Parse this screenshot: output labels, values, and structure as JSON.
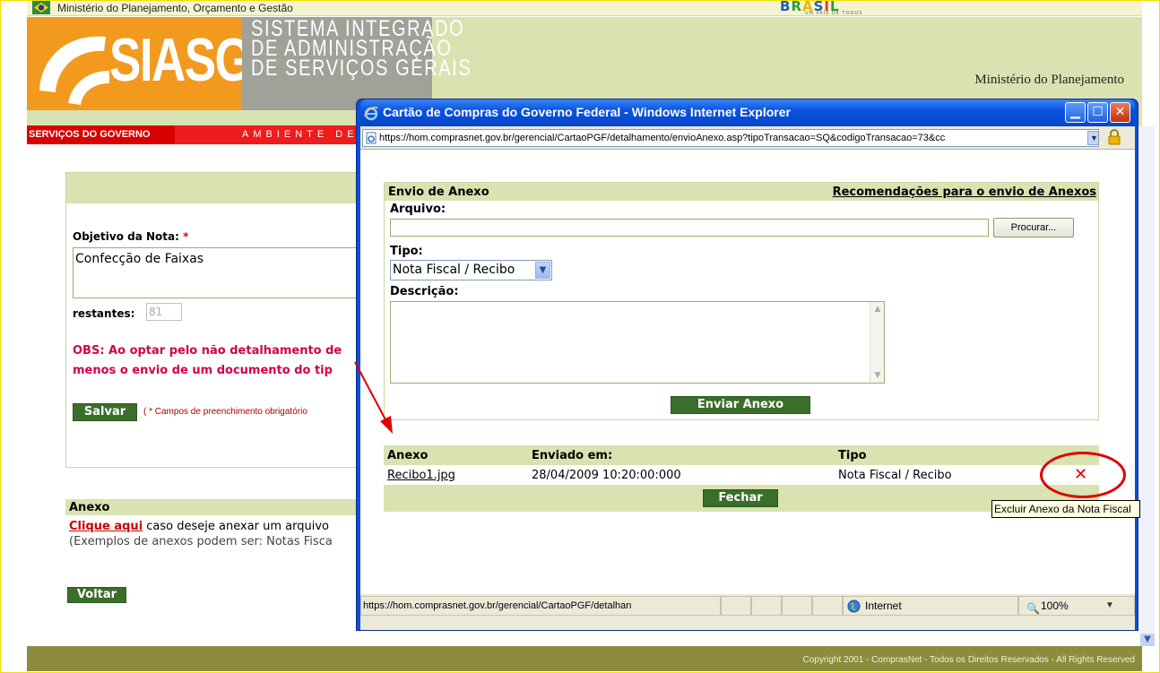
{
  "gov_bar": {
    "ministry": "Ministério do Planejamento, Orçamento e Gestão",
    "brasil_logo": "BRASIL",
    "brasil_tagline": "UM PAÍS DE TODOS"
  },
  "header": {
    "logo_text": "SIASG",
    "system_name": "SISTEMA INTEGRADO\nDE ADMINISTRAÇÃO\nDE SERVIÇOS GERAIS",
    "right_title": "Ministério do Planejamento",
    "services_label": "SERVIÇOS DO GOVERNO",
    "environment_label": "AMBIENTE DE"
  },
  "form": {
    "objetivo_label": "Objetivo da Nota:",
    "required_mark": "*",
    "objetivo_value": "Confecção de Faixas",
    "restantes_label": "restantes:",
    "restantes_value": "81",
    "obs_line1": "OBS: Ao optar pelo não detalhamento de",
    "obs_line2": "menos o envio de um documento do tip",
    "save_label": "Salvar",
    "required_note": "( * Campos de preenchimento obrigatório"
  },
  "anexo_section": {
    "title": "Anexo",
    "click_link": "Clique aqui",
    "line1_rest": " caso deseje anexar um arquivo",
    "line2": "(Exemplos de anexos podem ser: Notas Fisca"
  },
  "back_label": "Voltar",
  "footer_text": "Copyright 2001 - ComprasNet - Todos os Direitos Reservados - All Rights Reserved",
  "popup": {
    "title": "Cartão de Compras do Governo Federal - Windows Internet Explorer",
    "address": "https://hom.comprasnet.gov.br/gerencial/CartaoPGF/detalhamento/envioAnexo.asp?tipoTransacao=SQ&codigoTransacao=73&cc",
    "section_title": "Envio de Anexo",
    "recommendations_link": "Recomendações para o envio de Anexos",
    "arquivo_label": "Arquivo:",
    "browse_label": "Procurar...",
    "tipo_label": "Tipo:",
    "tipo_selected": "Nota Fiscal / Recibo",
    "descricao_label": "Descrição:",
    "send_label": "Enviar Anexo",
    "table_headers": [
      "Anexo",
      "Enviado em:",
      "Tipo"
    ],
    "rows": [
      {
        "anexo": "Recibo1.jpg",
        "enviado": "28/04/2009 10:20:00:000",
        "tipo": "Nota Fiscal / Recibo"
      }
    ],
    "close_label": "Fechar",
    "status_url": "https://hom.comprasnet.gov.br/gerencial/CartaoPGF/detalhan",
    "status_zone": "Internet",
    "zoom": "100%"
  },
  "tooltip": "Excluir Anexo da Nota Fiscal",
  "icons": {
    "gov": "brazil-flag-icon",
    "ie": "internet-explorer-icon",
    "page": "page-icon",
    "lock": "lock-icon",
    "delete": "delete-x-icon",
    "globe": "globe-icon",
    "zoom": "magnifier-icon"
  },
  "colors": {
    "header_green": "#d8e3b1",
    "button_green": "#3b6e2a",
    "alert_red": "#d4004a",
    "titlebar_blue": "#0a53e0",
    "annotation_red": "#e00000"
  }
}
